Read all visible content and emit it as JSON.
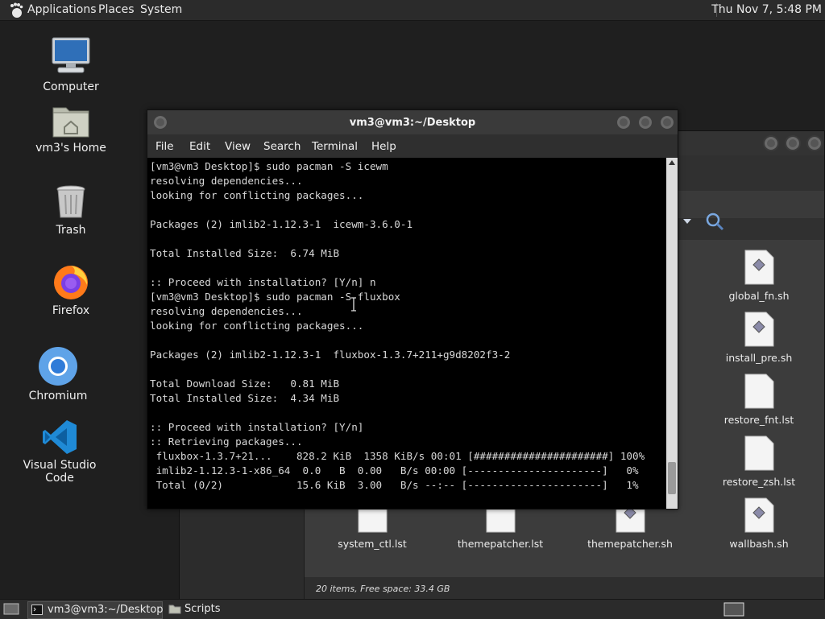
{
  "top_panel": {
    "menus": [
      "Applications",
      "Places",
      "System"
    ],
    "clock": "Thu Nov 7,  5:48 PM"
  },
  "desktop": {
    "icons": [
      {
        "label": "Computer",
        "icon": "computer-icon"
      },
      {
        "label": "vm3's Home",
        "icon": "home-folder-icon"
      },
      {
        "label": "Trash",
        "icon": "trash-icon"
      },
      {
        "label": "Firefox",
        "icon": "firefox-icon"
      },
      {
        "label": "Chromium",
        "icon": "chromium-icon"
      },
      {
        "label": "Visual Studio Code",
        "icon": "vscode-icon"
      }
    ]
  },
  "terminal": {
    "title": "vm3@vm3:~/Desktop",
    "menu": [
      "File",
      "Edit",
      "View",
      "Search",
      "Terminal",
      "Help"
    ],
    "lines": [
      "[vm3@vm3 Desktop]$ sudo pacman -S icewm",
      "resolving dependencies...",
      "looking for conflicting packages...",
      "",
      "Packages (2) imlib2-1.12.3-1  icewm-3.6.0-1",
      "",
      "Total Installed Size:  6.74 MiB",
      "",
      ":: Proceed with installation? [Y/n] n",
      "[vm3@vm3 Desktop]$ sudo pacman -S fluxbox",
      "resolving dependencies...",
      "looking for conflicting packages...",
      "",
      "Packages (2) imlib2-1.12.3-1  fluxbox-1.3.7+211+g9d8202f3-2",
      "",
      "Total Download Size:   0.81 MiB",
      "Total Installed Size:  4.34 MiB",
      "",
      ":: Proceed with installation? [Y/n]",
      ":: Retrieving packages...",
      " fluxbox-1.3.7+21...    828.2 KiB  1358 KiB/s 00:01 [######################] 100%",
      " imlib2-1.12.3-1-x86_64  0.0   B  0.00   B/s 00:00 [----------------------]   0%",
      " Total (0/2)            15.6 KiB  3.00   B/s --:-- [----------------------]   1%"
    ]
  },
  "file_manager": {
    "files": [
      {
        "name": "global_fn.sh",
        "type": "script"
      },
      {
        "name": "install_pre.sh",
        "type": "script"
      },
      {
        "name": "restore_fnt.lst",
        "type": "text"
      },
      {
        "name": "restore_zsh.lst",
        "type": "text"
      },
      {
        "name": "system_ctl.lst",
        "type": "text"
      },
      {
        "name": "themepatcher.lst",
        "type": "text"
      },
      {
        "name": "themepatcher.sh",
        "type": "script"
      },
      {
        "name": "wallbash.sh",
        "type": "script"
      }
    ],
    "status": "20 items, Free space: 33.4 GB"
  },
  "taskbar": {
    "tasks": [
      "vm3@vm3:~/Desktop",
      "Scripts"
    ]
  }
}
